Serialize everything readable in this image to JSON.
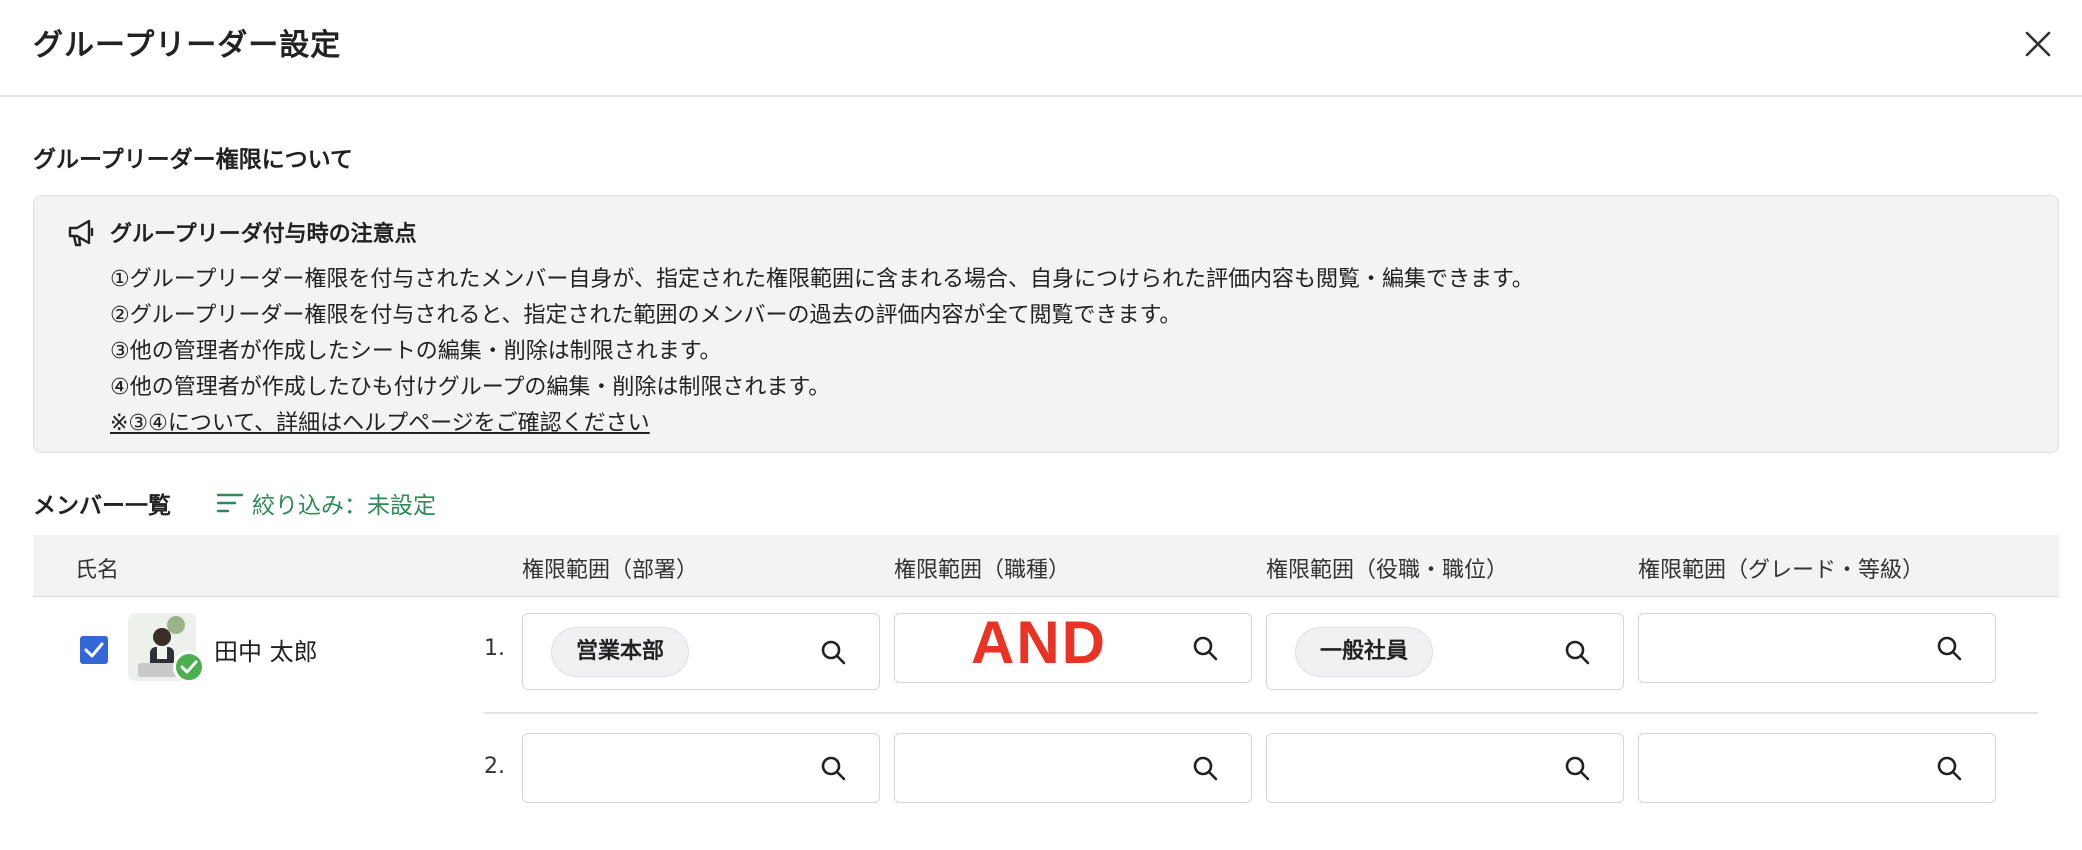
{
  "dialog": {
    "title": "グループリーダー設定",
    "close_icon": "close-icon"
  },
  "section": {
    "title": "グループリーダー権限について"
  },
  "notice": {
    "icon": "megaphone-icon",
    "title": "グループリーダ付与時の注意点",
    "lines": [
      "①グループリーダー権限を付与されたメンバー自身が、指定された権限範囲に含まれる場合、自身につけられた評価内容も閲覧・編集できます。",
      "②グループリーダー権限を付与されると、指定された範囲のメンバーの過去の評価内容が全て閲覧できます。",
      "③他の管理者が作成したシートの編集・削除は制限されます。",
      "④他の管理者が作成したひも付けグループの編集・削除は制限されます。"
    ],
    "link": "※③④について、詳細はヘルプページをご確認ください"
  },
  "members": {
    "title": "メンバー一覧",
    "filter_label": "絞り込み：未設定",
    "filter_icon": "filter-icon",
    "columns": [
      "氏名",
      "権限範囲（部署）",
      "権限範囲（職種）",
      "権限範囲（役職・職位）",
      "権限範囲（グレード・等級）"
    ],
    "rows": [
      {
        "name": "田中 太郎",
        "checked": true,
        "scopes": [
          {
            "number": "1.",
            "department": "営業本部",
            "job_type": "",
            "position": "一般社員",
            "grade": ""
          },
          {
            "number": "2.",
            "department": "",
            "job_type": "",
            "position": "",
            "grade": ""
          }
        ]
      }
    ]
  },
  "annotation": {
    "label": "AND",
    "color": "#ea3324"
  },
  "colors": {
    "accent_green": "#2e8b57",
    "checkbox_blue": "#3467d6",
    "status_green": "#4caf50"
  }
}
